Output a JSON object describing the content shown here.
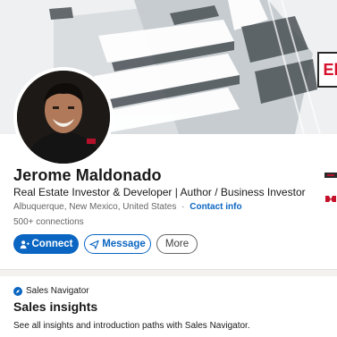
{
  "profile": {
    "name": "Jerome Maldonado",
    "headline": "Real Estate Investor & Developer | Author / Business Investor",
    "location": "Albuquerque, New Mexico, United States",
    "separator": "·",
    "contact_label": "Contact info",
    "connections": "500+ connections",
    "banner_logo_text": "El"
  },
  "actions": {
    "connect_label": "Connect",
    "message_label": "Message",
    "more_label": "More"
  },
  "sales_navigator": {
    "badge_label": "Sales Navigator",
    "title": "Sales insights",
    "subtitle": "See all insights and introduction paths with Sales Navigator."
  },
  "colors": {
    "primary": "#0a66c2",
    "background": "#f4f2ee",
    "accent_red": "#d4102b"
  },
  "icons": {
    "connect": "add-user-icon",
    "message": "paper-plane-icon",
    "sales_navigator": "compass-icon"
  }
}
